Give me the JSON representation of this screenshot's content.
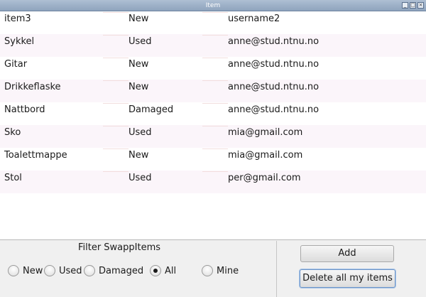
{
  "window": {
    "title": "Item"
  },
  "items": [
    {
      "name": "item3",
      "condition": "New",
      "owner": "username2"
    },
    {
      "name": "Sykkel",
      "condition": "Used",
      "owner": "anne@stud.ntnu.no"
    },
    {
      "name": "Gitar",
      "condition": "New",
      "owner": "anne@stud.ntnu.no"
    },
    {
      "name": "Drikkeflaske",
      "condition": "New",
      "owner": "anne@stud.ntnu.no"
    },
    {
      "name": "Nattbord",
      "condition": "Damaged",
      "owner": "anne@stud.ntnu.no"
    },
    {
      "name": "Sko",
      "condition": "Used",
      "owner": "mia@gmail.com"
    },
    {
      "name": "Toalettmappe",
      "condition": "New",
      "owner": "mia@gmail.com"
    },
    {
      "name": "Stol",
      "condition": "Used",
      "owner": "per@gmail.com"
    }
  ],
  "filter": {
    "title": "Filter SwappItems",
    "options": [
      {
        "label": "New",
        "checked": false
      },
      {
        "label": "Used",
        "checked": false
      },
      {
        "label": "Damaged",
        "checked": false
      },
      {
        "label": "All",
        "checked": true
      },
      {
        "label": "Mine",
        "checked": false
      }
    ]
  },
  "actions": {
    "add_label": "Add",
    "delete_label": "Delete all my items"
  }
}
